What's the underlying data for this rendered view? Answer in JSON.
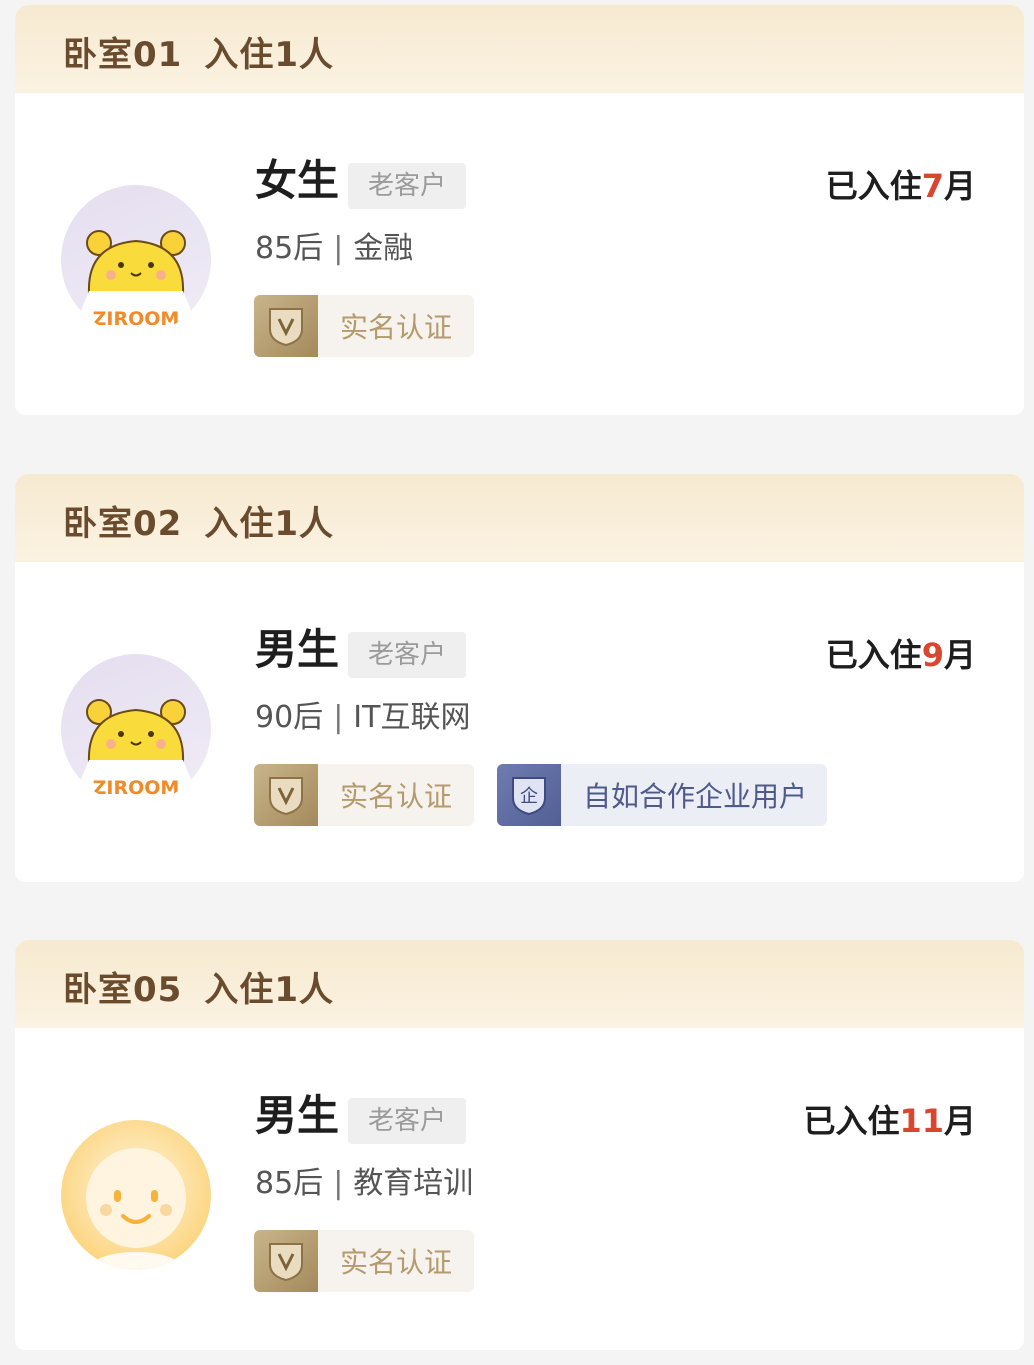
{
  "rooms": [
    {
      "name": "卧室01",
      "occupancy": "入住1人",
      "gender": "女生",
      "customer_tag": "老客户",
      "stay_prefix": "已入住",
      "stay_number": "7",
      "stay_suffix": "月",
      "age_group": "85后",
      "separator": "|",
      "industry": "金融",
      "avatar_text": "ZIROOM",
      "badges": {
        "verified": "实名认证"
      }
    },
    {
      "name": "卧室02",
      "occupancy": "入住1人",
      "gender": "男生",
      "customer_tag": "老客户",
      "stay_prefix": "已入住",
      "stay_number": "9",
      "stay_suffix": "月",
      "age_group": "90后",
      "separator": "|",
      "industry": "IT互联网",
      "avatar_text": "ZIROOM",
      "badges": {
        "verified": "实名认证",
        "corporate": "自如合作企业用户",
        "corporate_icon_char": "企"
      }
    },
    {
      "name": "卧室05",
      "occupancy": "入住1人",
      "gender": "男生",
      "customer_tag": "老客户",
      "stay_prefix": "已入住",
      "stay_number": "11",
      "stay_suffix": "月",
      "age_group": "85后",
      "separator": "|",
      "industry": "教育培训",
      "badges": {
        "verified": "实名认证"
      }
    }
  ],
  "colors": {
    "header_bg": "#f6ead0",
    "title_text": "#6a4b2e",
    "stay_number": "#d8462f",
    "verify_gold": "#a38a5c",
    "corp_blue": "#525f96"
  },
  "icons": {
    "avatar_default": "bear-avatar-icon",
    "avatar_smiley": "smiley-avatar-icon",
    "verify": "v-shield-icon",
    "corporate": "corporate-shield-icon"
  }
}
